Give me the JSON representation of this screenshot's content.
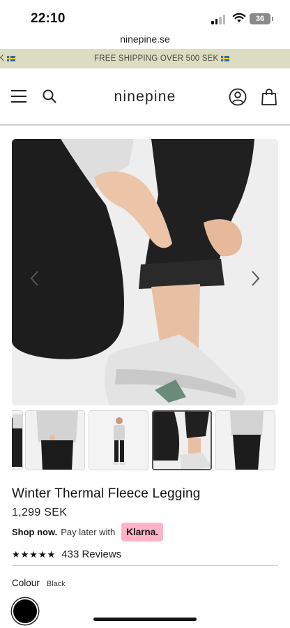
{
  "status_bar": {
    "time": "22:10",
    "battery": "36"
  },
  "browser": {
    "url": "ninepine.se"
  },
  "banner": {
    "message": "FREE SHIPPING OVER 500 SEK",
    "partial_message": "K"
  },
  "header": {
    "logo": "ninepine",
    "icons": [
      "menu-icon",
      "search-icon",
      "account-icon",
      "bag-icon"
    ]
  },
  "gallery": {
    "thumbnail_count_visible": 5,
    "selected_thumbnail": 4
  },
  "product": {
    "title": "Winter Thermal Fleece Legging",
    "price": "1,299 SEK",
    "shop_now": "Shop now.",
    "pay_later": "Pay later with",
    "klarna": "Klarna.",
    "rating_stars": "★★★★★",
    "rating": 4.5,
    "reviews": "433 Reviews",
    "colour_label": "Colour",
    "colour_value": "Black",
    "colour_swatch": "#000000"
  },
  "colors": {
    "banner_bg": "#dcdcc3",
    "klarna_pink": "#ffb3c7"
  }
}
